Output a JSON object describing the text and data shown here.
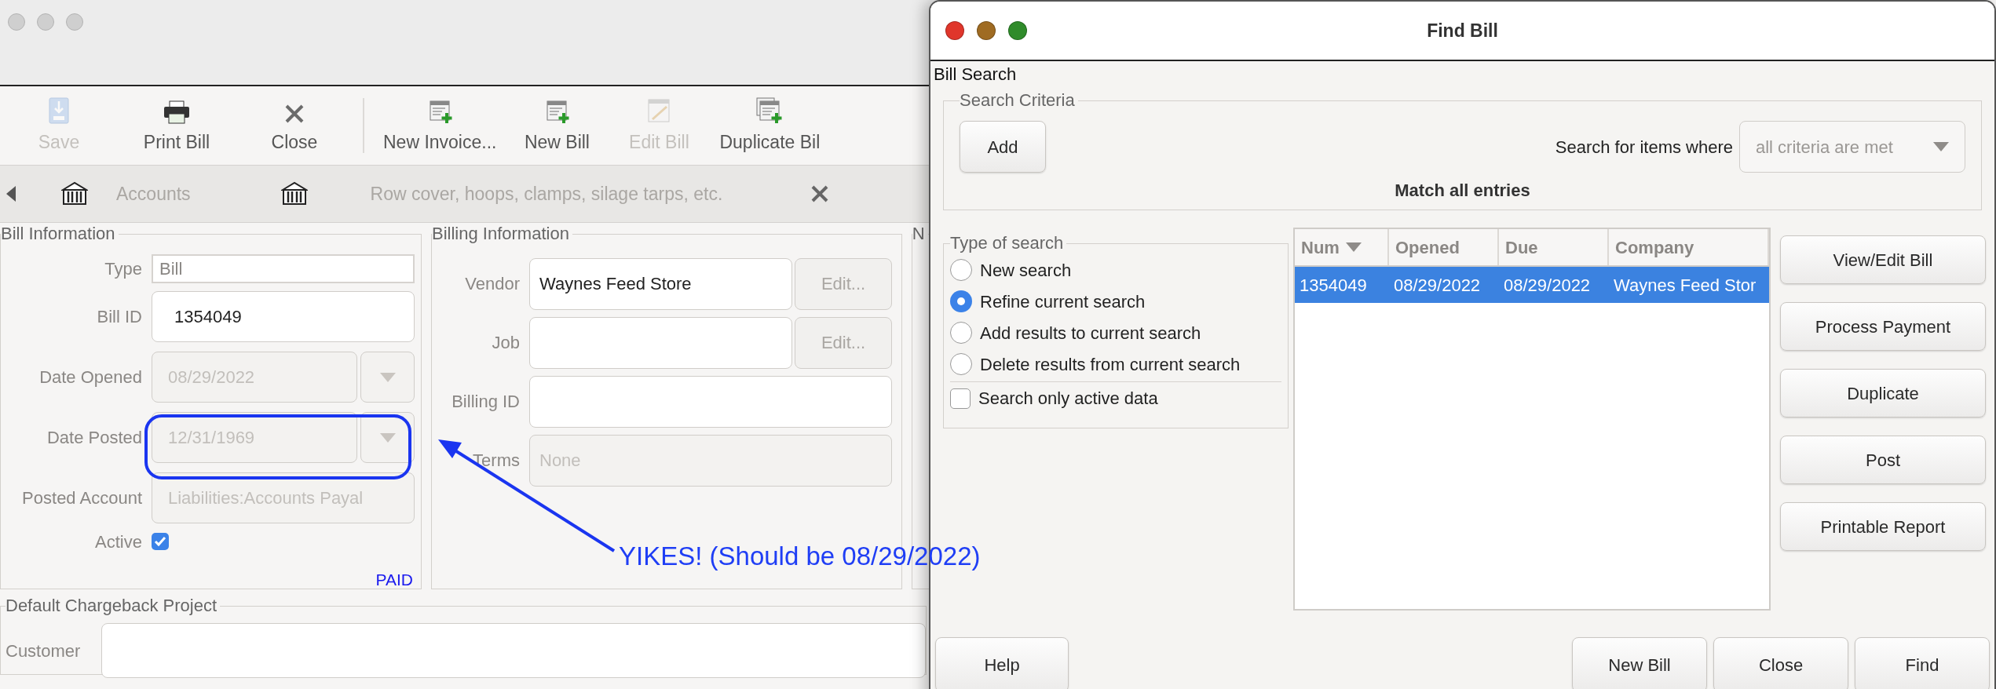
{
  "back_window": {
    "toolbar_groups": [
      {
        "items": [
          {
            "label": "Save",
            "disabled": true
          },
          {
            "label": "Print Bill",
            "disabled": false
          },
          {
            "label": "Close",
            "disabled": false
          }
        ]
      },
      {
        "items": [
          {
            "label": "New Invoice...",
            "disabled": false
          },
          {
            "label": "New Bill",
            "disabled": false
          },
          {
            "label": "Edit Bill",
            "disabled": true
          },
          {
            "label": "Duplicate Bil",
            "disabled": false
          }
        ]
      }
    ],
    "nav_bar": {
      "items": [
        {
          "label": "Accounts"
        },
        {
          "label": "Row cover, hoops, clamps, silage tarps, etc."
        }
      ]
    },
    "bill_information": {
      "title": "Bill Information",
      "fields": [
        {
          "label": "Type",
          "kind": "plain",
          "value": "Bill",
          "disabled": true
        },
        {
          "label": "Bill ID",
          "kind": "text",
          "value": "1354049",
          "disabled": false
        },
        {
          "label": "Date Opened",
          "kind": "date",
          "value": "08/29/2022",
          "disabled": true
        },
        {
          "label": "Date Posted",
          "kind": "date",
          "value": "12/31/1969",
          "disabled": true
        },
        {
          "label": "Posted Account",
          "kind": "text",
          "value": "Liabilities:Accounts Payal",
          "disabled": true
        },
        {
          "label": "Active",
          "kind": "checkbox",
          "checked": true
        }
      ],
      "status": "PAID"
    },
    "billing_information": {
      "title": "Billing Information",
      "fields": [
        {
          "label": "Vendor",
          "value": "Waynes Feed Store",
          "button": "Edit...",
          "disabled": false
        },
        {
          "label": "Job",
          "button": "Edit...",
          "disabled": false
        },
        {
          "label": "Billing ID",
          "disabled": false
        },
        {
          "label": "Terms",
          "value": "None",
          "disabled": true
        }
      ]
    },
    "panel_3": {
      "title": "N"
    },
    "chargeback": {
      "title": "Default Chargeback Project",
      "customer_label": "Customer"
    }
  },
  "annotation": {
    "text": "YIKES! (Should be 08/29/2022)"
  },
  "find_window": {
    "title": "Find Bill",
    "section": "Bill Search",
    "criteria": {
      "title": "Search Criteria",
      "add_button": "Add",
      "match_label": "Search for items where",
      "match_value": "all criteria are met",
      "summary": "Match all entries"
    },
    "search_type": {
      "title": "Type of search",
      "options": [
        {
          "label": "New search",
          "selected": false
        },
        {
          "label": "Refine current search",
          "selected": true
        },
        {
          "label": "Add results to current search",
          "selected": false
        },
        {
          "label": "Delete results from current search",
          "selected": false
        }
      ],
      "active_only": {
        "label": "Search only active data",
        "checked": false
      }
    },
    "results": {
      "columns": [
        {
          "label": "Num",
          "sorted": true
        },
        {
          "label": "Opened",
          "sorted": false
        },
        {
          "label": "Due",
          "sorted": false
        },
        {
          "label": "Company",
          "sorted": false
        }
      ],
      "rows": [
        {
          "cells": [
            "1354049",
            "08/29/2022",
            "08/29/2022",
            "Waynes Feed Stor"
          ],
          "selected": true
        }
      ]
    },
    "side_buttons": [
      "View/Edit Bill",
      "Process Payment",
      "Duplicate",
      "Post",
      "Printable Report"
    ],
    "footer_left": [
      "Help"
    ],
    "footer_right": [
      "New Bill",
      "Close",
      "Find"
    ]
  }
}
